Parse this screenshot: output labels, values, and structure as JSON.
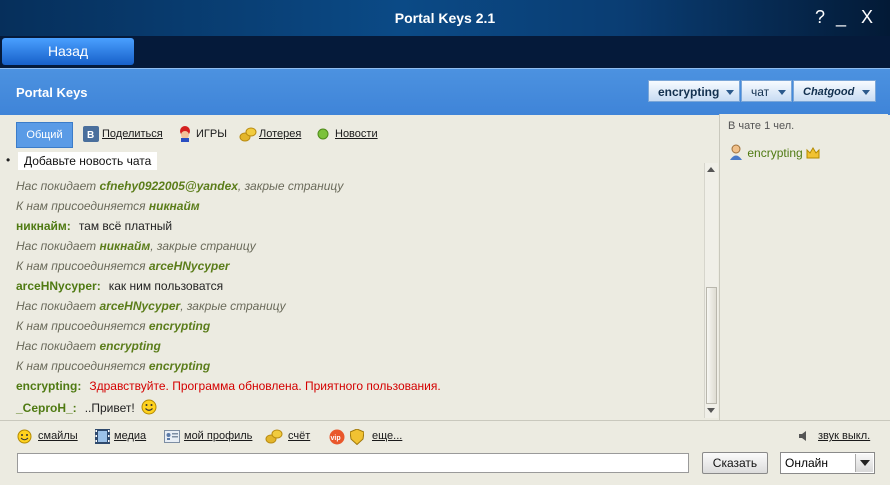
{
  "window": {
    "title": "Portal Keys 2.1",
    "help": "?",
    "minimize": "_",
    "close": "X"
  },
  "nav": {
    "back_label": "Назад"
  },
  "header": {
    "app_name": "Portal Keys",
    "user_combo": "encrypting",
    "mode_combo": "чат",
    "service_combo": "Chatgood"
  },
  "toplinks": {
    "general_tab": "Общий",
    "share": "Поделиться",
    "games": "ИГРЫ",
    "lottery": "Лотерея",
    "news": "Новости"
  },
  "news": {
    "bullet": "•",
    "label": "Добавьте новость чата"
  },
  "messages": [
    {
      "type": "system",
      "prefix": "Нас покидает ",
      "nick": "cfnehy0922005@yandex",
      "suffix": ", закрые страницу"
    },
    {
      "type": "system",
      "prefix": "К нам присоединяется ",
      "nick": "никнайм",
      "suffix": ""
    },
    {
      "type": "chat",
      "speaker": "никнайм:",
      "text": "там всё платный"
    },
    {
      "type": "system",
      "prefix": "Нас покидает ",
      "nick": "никнайм",
      "suffix": ", закрые страницу"
    },
    {
      "type": "system",
      "prefix": "К нам присоединяется ",
      "nick": "arceHNycyper",
      "suffix": ""
    },
    {
      "type": "chat",
      "speaker": "arceHNycyper:",
      "text": "как ним пользоватся"
    },
    {
      "type": "system",
      "prefix": "Нас покидает ",
      "nick": "arceHNycyper",
      "suffix": ", закрые страницу"
    },
    {
      "type": "system",
      "prefix": "К нам присоединяется ",
      "nick": "encrypting",
      "suffix": ""
    },
    {
      "type": "system",
      "prefix": "Нас покидает ",
      "nick": "encrypting",
      "suffix": ""
    },
    {
      "type": "system",
      "prefix": "К нам присоединяется ",
      "nick": "encrypting",
      "suffix": ""
    },
    {
      "type": "chat",
      "speaker": "encrypting:",
      "text": "Здравствуйте. Программа обновлена. Приятного пользования.",
      "color": "#d40000"
    },
    {
      "type": "chat",
      "speaker": "_СерroH_:",
      "text": "..Привет!",
      "emoji": "smile"
    }
  ],
  "users_panel": {
    "count_label": "В чате 1 чел.",
    "users": [
      "encrypting"
    ]
  },
  "bottom": {
    "smileys": "смайлы",
    "media": "медиа",
    "profile": "мой профиль",
    "account": "счёт",
    "more": "еще...",
    "sound": "звук выкл.",
    "send_label": "Сказать",
    "status_value": "Онлайн",
    "message_value": ""
  },
  "colors": {
    "accent_blue": "#3f84d8",
    "nick_green": "#5b7d1a",
    "alert_red": "#d40000",
    "titlebar": "#0b4a86"
  }
}
